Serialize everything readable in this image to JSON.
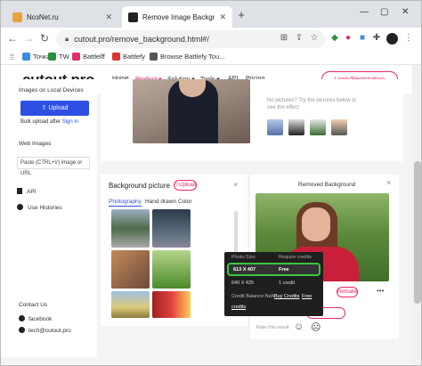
{
  "browser": {
    "tabs": [
      {
        "title": "NoзNet.ru",
        "active": false
      },
      {
        "title": "Remove Image Background for F",
        "active": true
      }
    ],
    "new_tab": "+",
    "url": "cutout.pro/remove_background.html#/",
    "bookmarks": [
      {
        "label": "Точка",
        "color": "#3b8edd"
      },
      {
        "label": "TW",
        "color": "#2a8f3a"
      },
      {
        "label": "Battlelff",
        "color": "#e1306c"
      },
      {
        "label": "Battlefy",
        "color": "#d33"
      },
      {
        "label": "Browse Battlefy Tou...",
        "color": "#555"
      }
    ]
  },
  "site": {
    "logo": "cutout.pro",
    "nav": [
      "Home",
      "Product ▾",
      "Solution ▾",
      "Tools ▾",
      "API",
      "Pricing"
    ],
    "login_label": "Login/Registration",
    "accent": "#e6296a",
    "blue": "#2e50e2"
  },
  "sidebar": {
    "images_local": "Images on Local Devices",
    "upload_label": "Upload",
    "bulk_text": "Bulk upload after",
    "signin": "Sign in",
    "web_images": "Web Images",
    "paste_placeholder": "Paste (CTRL+V) image or URL",
    "api": "API",
    "histories": "Use Histories",
    "contact": "Contact Us",
    "facebook": "facebook",
    "email": "tech@cutout.pro"
  },
  "upload_area": {
    "hint": "No pictures? Try the pictures below to see the effect"
  },
  "bg_panel": {
    "title": "Background picture",
    "upload_label": "Upload",
    "close": "×",
    "tabs": [
      "Photography",
      "Hand drawn",
      "Color"
    ]
  },
  "result_panel": {
    "title": "Removed Background",
    "close": "×",
    "remake": "Remake",
    "more": "•••",
    "rate": "Rate this result"
  },
  "popup": {
    "header_size": "Photo Size",
    "header_credits": "Require credits",
    "rows": [
      {
        "size": "613 X 407",
        "credits": "Free",
        "highlighted": true
      },
      {
        "size": "640 X 425",
        "credits": "1 credit",
        "highlighted": false
      }
    ],
    "balance_label": "Credit Balance:NaN",
    "buy_label": "Buy Credits",
    "free_label": "Free",
    "credits_label": "credits"
  }
}
